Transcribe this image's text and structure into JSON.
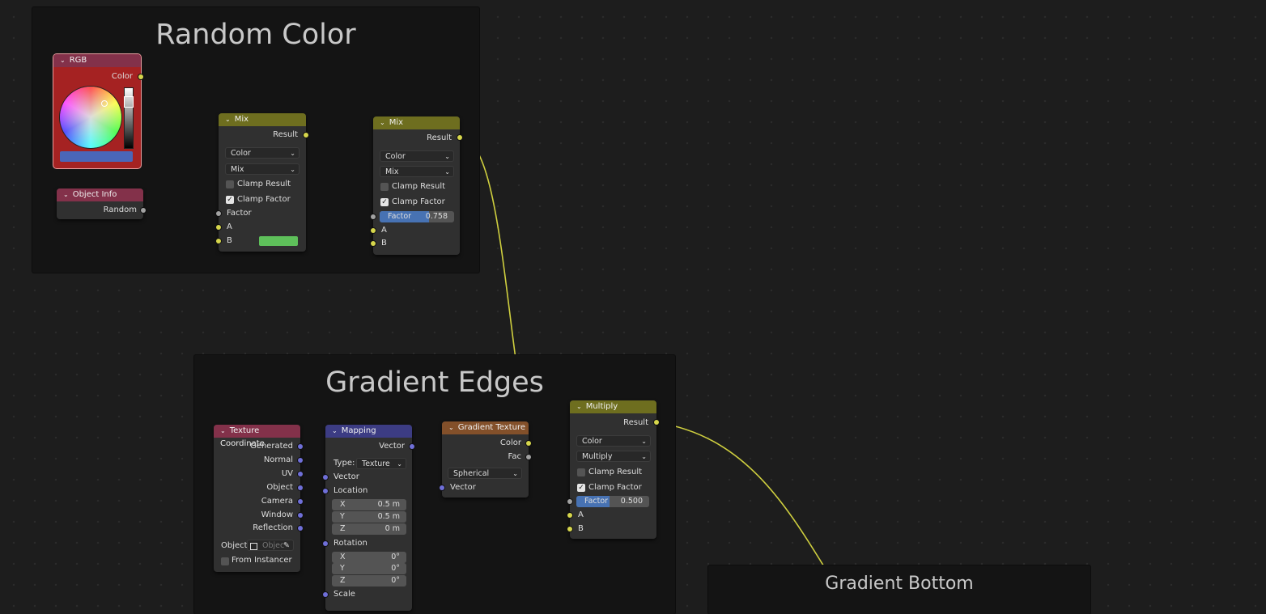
{
  "frames": {
    "random_color": "Random Color",
    "gradient_edges": "Gradient Edges",
    "gradient_bottom": "Gradient Bottom"
  },
  "rgb_node": {
    "title": "RGB",
    "output": "Color",
    "header_color": "#83314a",
    "body_color": "#a52222",
    "swatch_color": "#4a66b8"
  },
  "object_info": {
    "title": "Object Info",
    "output": "Random",
    "header_color": "#83314a"
  },
  "mix1": {
    "title": "Mix",
    "header_color": "#6e6e1f",
    "output": "Result",
    "data_type": "Color",
    "blend": "Mix",
    "clamp_result": "Clamp Result",
    "clamp_factor": "Clamp Factor",
    "factor": "Factor",
    "a": "A",
    "b": "B",
    "b_color": "#5ec05a"
  },
  "mix2": {
    "title": "Mix",
    "header_color": "#6e6e1f",
    "output": "Result",
    "data_type": "Color",
    "blend": "Mix",
    "clamp_result": "Clamp Result",
    "clamp_factor": "Clamp Factor",
    "factor_label": "Factor",
    "factor_value": "0.758",
    "factor_fraction": 0.758,
    "a": "A",
    "b": "B"
  },
  "tex_coord": {
    "title": "Texture Coordinate",
    "header_color": "#83314a",
    "outputs": [
      "Generated",
      "Normal",
      "UV",
      "Object",
      "Camera",
      "Window",
      "Reflection"
    ],
    "object_label": "Object:",
    "object_placeholder": "Objec",
    "from_instancer": "From Instancer"
  },
  "mapping": {
    "title": "Mapping",
    "header_color": "#3c3c83",
    "output": "Vector",
    "type_label": "Type:",
    "type_value": "Texture",
    "vector": "Vector",
    "location": "Location",
    "rotation": "Rotation",
    "scale": "Scale",
    "loc": [
      {
        "axis": "X",
        "value": "0.5 m"
      },
      {
        "axis": "Y",
        "value": "0.5 m"
      },
      {
        "axis": "Z",
        "value": "0 m"
      }
    ],
    "rot": [
      {
        "axis": "X",
        "value": "0°"
      },
      {
        "axis": "Y",
        "value": "0°"
      },
      {
        "axis": "Z",
        "value": "0°"
      }
    ]
  },
  "gradient_tex": {
    "title": "Gradient Texture",
    "header_color": "#83502a",
    "out_color": "Color",
    "out_fac": "Fac",
    "type": "Spherical",
    "vector": "Vector"
  },
  "multiply": {
    "title": "Multiply",
    "header_color": "#6e6e1f",
    "output": "Result",
    "data_type": "Color",
    "blend": "Multiply",
    "clamp_result": "Clamp Result",
    "clamp_factor": "Clamp Factor",
    "factor_label": "Factor",
    "factor_value": "0.500",
    "factor_fraction": 0.5,
    "a": "A",
    "b": "B"
  },
  "colors": {
    "wire_yellow": "#cfcf3f",
    "wire_white": "#d8d8c8",
    "wire_grey": "#9c9c9c",
    "wire_blue": "#6060c0"
  }
}
